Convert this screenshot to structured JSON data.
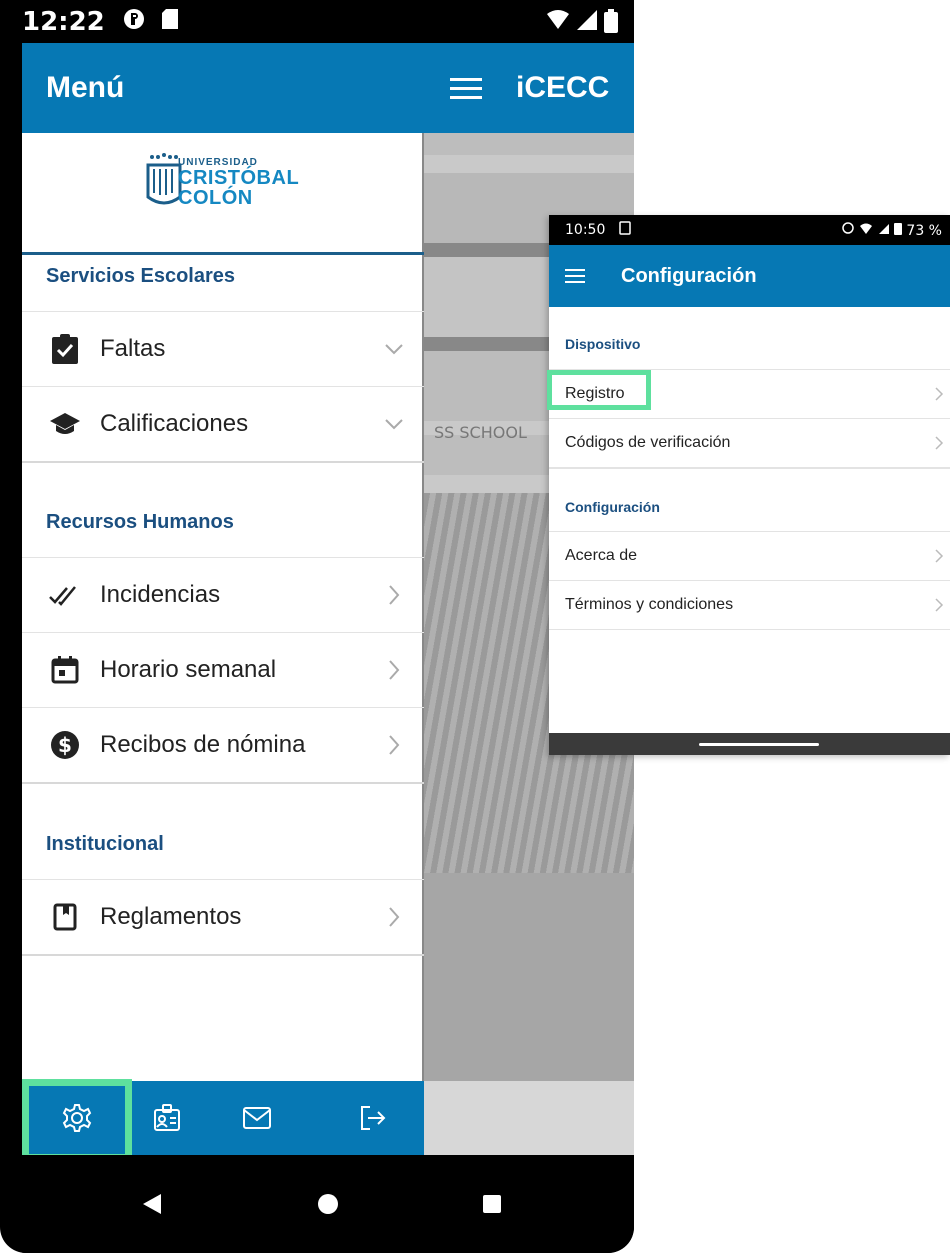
{
  "phone1": {
    "status": {
      "time": "12:22"
    },
    "drawer": {
      "header": "Menú",
      "logo": {
        "line1": "UNIVERSIDAD",
        "line2": "CRISTÓBAL",
        "line3": "COLÓN"
      },
      "sections": [
        {
          "title": "Servicios Escolares",
          "items": [
            {
              "label": "Faltas",
              "icon": "clipboard-check-icon",
              "chevron": "down"
            },
            {
              "label": "Calificaciones",
              "icon": "graduation-cap-icon",
              "chevron": "down"
            }
          ]
        },
        {
          "title": "Recursos Humanos",
          "items": [
            {
              "label": "Incidencias",
              "icon": "double-check-icon",
              "chevron": "right"
            },
            {
              "label": "Horario semanal",
              "icon": "calendar-icon",
              "chevron": "right"
            },
            {
              "label": "Recibos de nómina",
              "icon": "dollar-icon",
              "chevron": "right"
            }
          ]
        },
        {
          "title": "Institucional",
          "items": [
            {
              "label": "Reglamentos",
              "icon": "book-icon",
              "chevron": "right"
            }
          ]
        }
      ]
    },
    "background_app": {
      "title": "iCECC",
      "sign": "SS SCHOOL"
    },
    "tabbar": [
      "gear-icon",
      "id-card-icon",
      "mail-icon",
      "logout-icon"
    ],
    "accent": "#0678b4",
    "highlight": "#5ee09e"
  },
  "phone2": {
    "status": {
      "time": "10:50",
      "battery": "73 %"
    },
    "title": "Configuración",
    "sections": [
      {
        "title": "Dispositivo",
        "items": [
          "Registro",
          "Códigos de verificación"
        ]
      },
      {
        "title": "Configuración",
        "items": [
          "Acerca de",
          "Términos y condiciones"
        ]
      }
    ]
  }
}
